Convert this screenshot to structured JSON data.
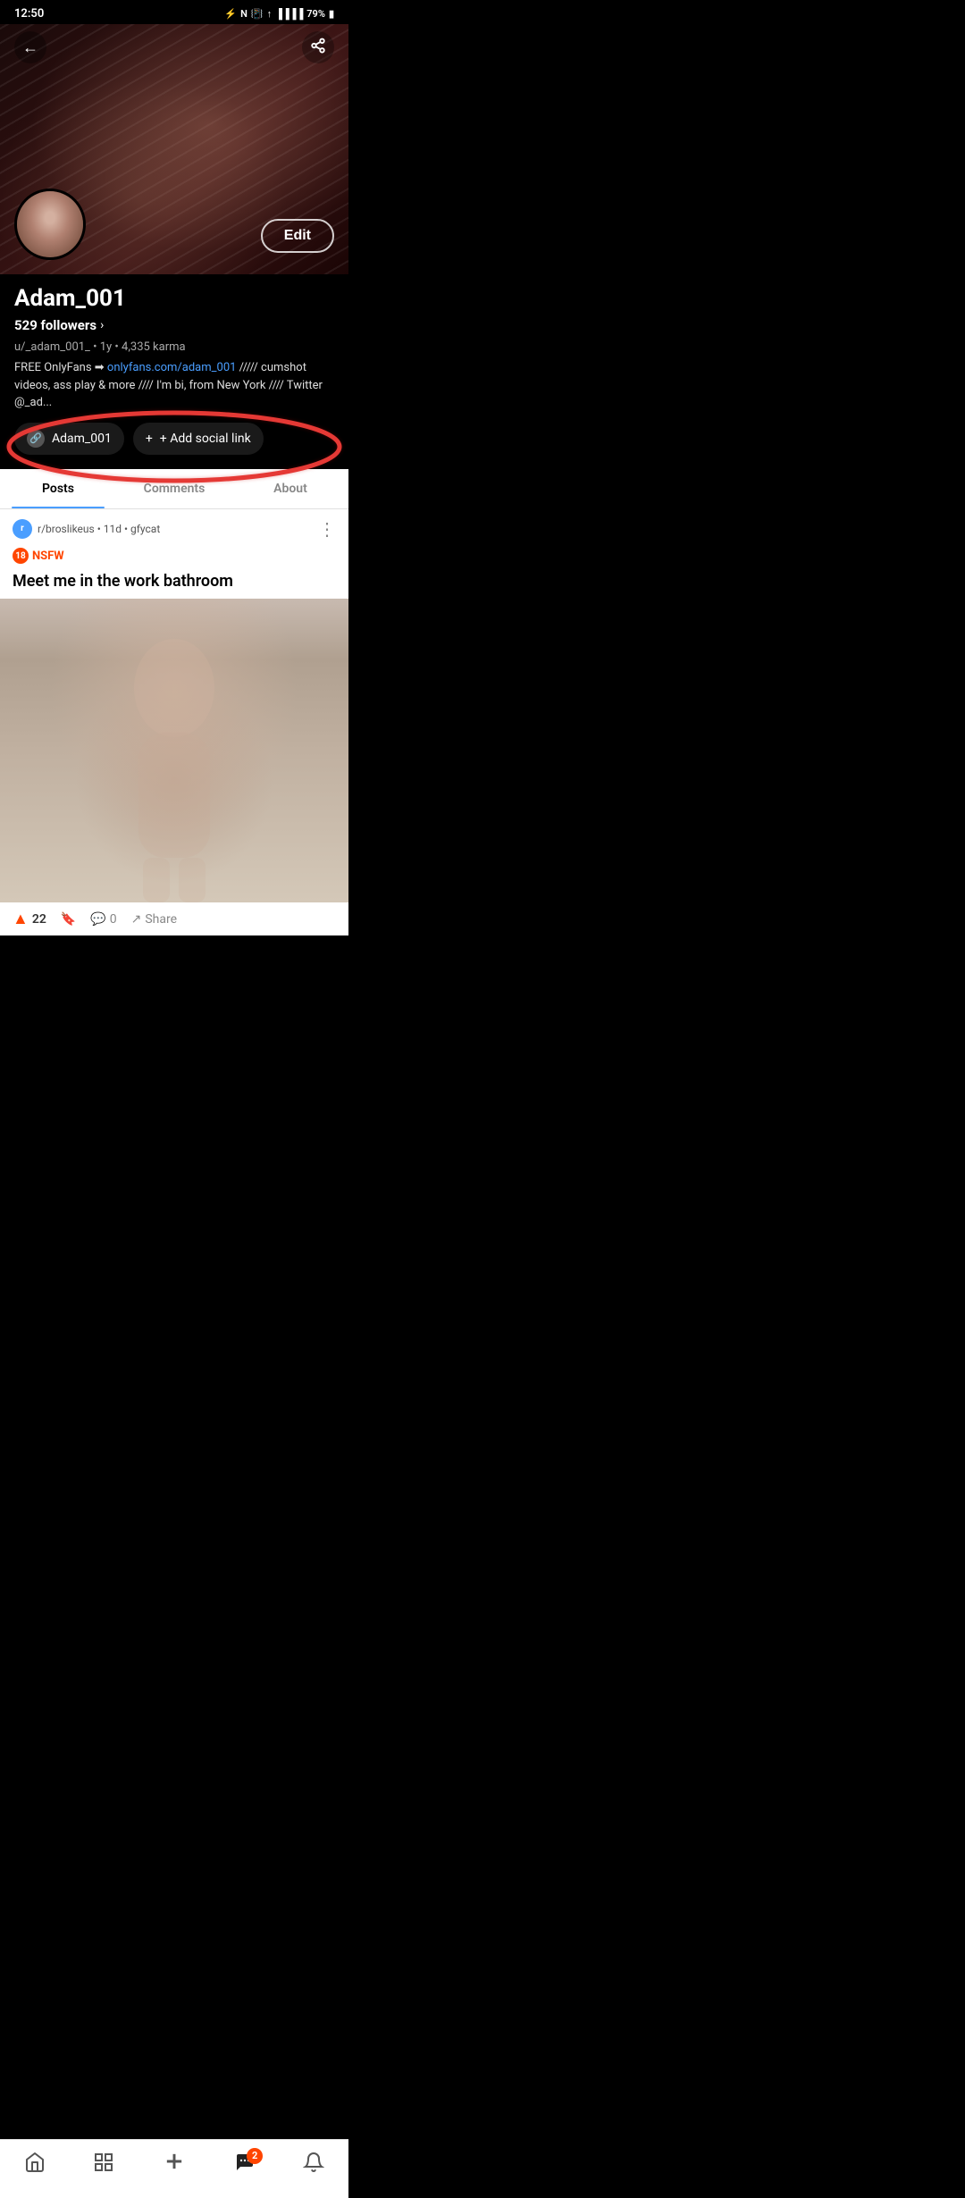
{
  "statusBar": {
    "time": "12:50",
    "battery": "79%",
    "batteryIcon": "🔋"
  },
  "nav": {
    "backLabel": "←",
    "shareLabel": "⋯"
  },
  "profile": {
    "username": "Adam_001",
    "followers": "529 followers",
    "meta": "u/_adam_001_ • 1y • 4,335 karma",
    "bio": "FREE OnlyFans ➡ onlyfans.com/adam_001 ///// cumshot videos, ass play & more //// I'm bi, from New York //// Twitter @_ad...",
    "bioLinkText": "onlyfans.com/adam_001",
    "bioLinkUrl": "#",
    "editLabel": "Edit"
  },
  "socialLinks": {
    "profileLink": {
      "label": "Adam_001",
      "icon": "🔗"
    },
    "addLink": {
      "label": "+ Add social link"
    }
  },
  "tabs": [
    {
      "id": "posts",
      "label": "Posts",
      "active": true
    },
    {
      "id": "comments",
      "label": "Comments",
      "active": false
    },
    {
      "id": "about",
      "label": "About",
      "active": false
    }
  ],
  "post": {
    "subreddit": "r/broslikeus",
    "subredditInitial": "r",
    "age": "11d",
    "source": "gfycat",
    "nsfw": "NSFW",
    "nsfwLabel": "18",
    "title": "Meet me in the work bathroom",
    "upvotes": "22",
    "comments": "0",
    "shares": "Share"
  },
  "bottomNav": {
    "home": "🏠",
    "grid": "⊞",
    "add": "+",
    "chat": "💬",
    "chatBadge": "2",
    "bell": "🔔"
  }
}
